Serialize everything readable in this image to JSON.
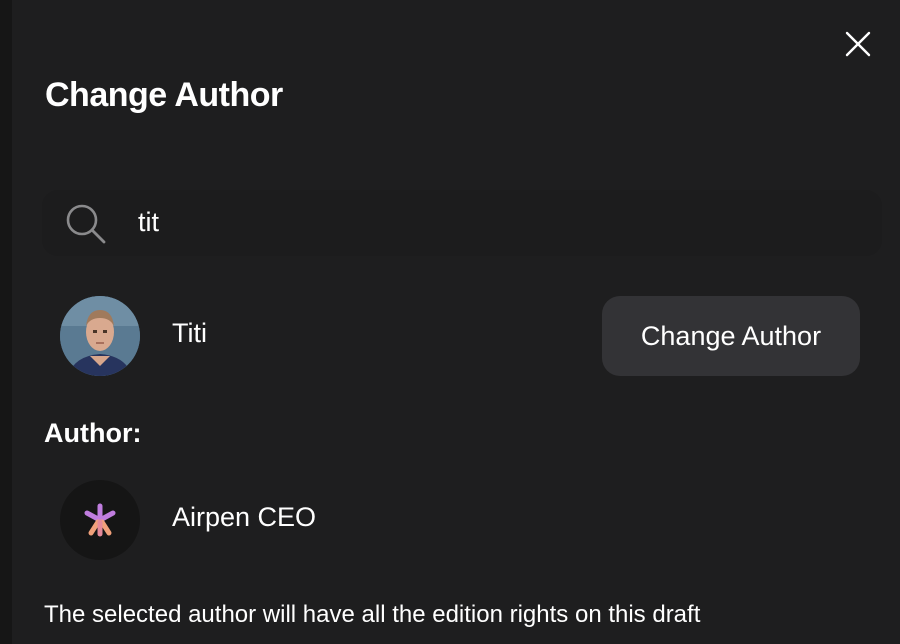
{
  "dialog": {
    "title": "Change Author",
    "close_icon": "close-icon"
  },
  "search": {
    "icon": "search-icon",
    "value": "tit",
    "placeholder": ""
  },
  "results": [
    {
      "name": "Titi",
      "avatar": "user-photo",
      "action_label": "Change Author"
    }
  ],
  "current_author": {
    "label": "Author:",
    "name": "Airpen CEO",
    "avatar_icon": "asterisk-logo-icon"
  },
  "footer_note": "The selected author will have all the edition rights on this draft",
  "colors": {
    "background": "#1e1e1f",
    "button": "#333336",
    "text": "#ffffff",
    "logo_purple": "#c07ddf",
    "logo_orange": "#f0a07a"
  }
}
